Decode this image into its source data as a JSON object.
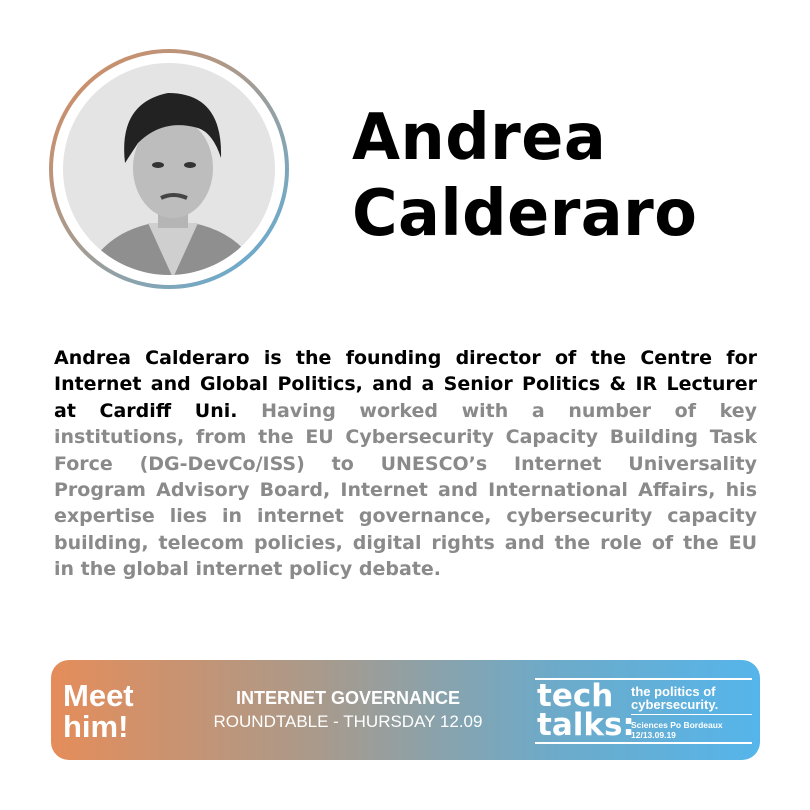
{
  "speaker": {
    "first_name": "Andrea",
    "last_name": "Calderaro",
    "photo": "portrait-photo"
  },
  "bio_lines": [
    [
      {
        "c": "k",
        "t": "Andrea Calderaro is the founding director of the Centre for"
      }
    ],
    [
      {
        "c": "k",
        "t": "Internet and Global Politics, and a Senior Politics & IR Lecturer"
      }
    ],
    [
      {
        "c": "k",
        "t": "at Cardiff Uni. "
      },
      {
        "c": "g",
        "t": "Having worked with a number of key"
      }
    ],
    [
      {
        "c": "g",
        "t": "institutions, from the EU Cybersecurity Capacity Building Task"
      }
    ],
    [
      {
        "c": "g",
        "t": "Force (DG-DevCo/ISS) to UNESCO’s Internet Universality"
      }
    ],
    [
      {
        "c": "g",
        "t": "Program Advisory Board, Internet and International Affairs, his"
      }
    ],
    [
      {
        "c": "g",
        "t": "expertise lies in internet governance, cybersecurity capacity"
      }
    ],
    [
      {
        "c": "g",
        "t": "building, telecom policies, digital rights and the role of the EU"
      }
    ],
    [
      {
        "c": "g",
        "t": "in the global internet policy debate."
      }
    ]
  ],
  "banner": {
    "meet_line1": "Meet",
    "meet_line2": "him!",
    "topic_title": "INTERNET GOVERNANCE",
    "topic_subtitle": "ROUNDTABLE - THURSDAY 12.09",
    "logo": {
      "line1": "tech",
      "line2": "talks:",
      "tagline1": "the politics of",
      "tagline2": "cybersecurity.",
      "org": "Sciences Po Bordeaux",
      "dates": "12/13.09.19"
    }
  },
  "colors": {
    "text": "#000000",
    "muted": "#8a8a8a",
    "gradient_start": "#e58d5a",
    "gradient_end": "#55b5ea"
  }
}
